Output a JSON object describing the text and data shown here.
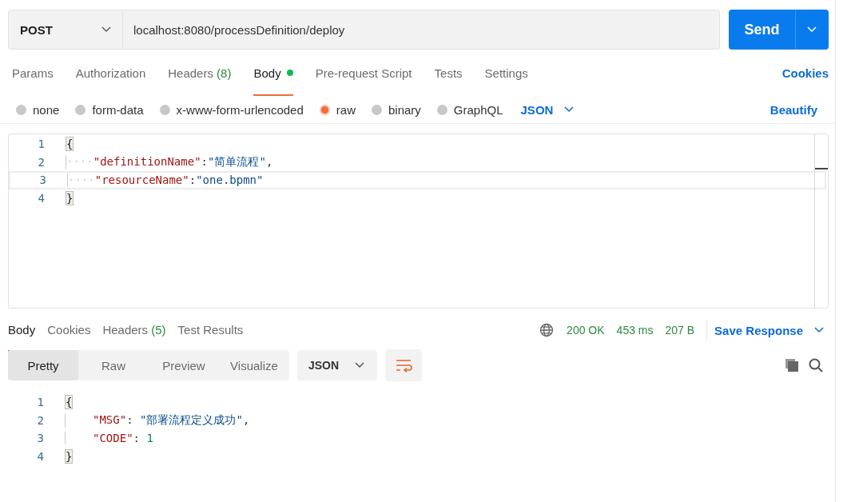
{
  "request": {
    "method": "POST",
    "url": "localhost:8080/processDefinition/deploy",
    "send": "Send"
  },
  "request_tabs": [
    {
      "label": "Params",
      "selected": false,
      "dot": false
    },
    {
      "label": "Authorization",
      "selected": false,
      "dot": false
    },
    {
      "label": "Headers",
      "count": "(8)",
      "selected": false,
      "dot": false
    },
    {
      "label": "Body",
      "selected": true,
      "dot": true
    },
    {
      "label": "Pre-request Script",
      "selected": false,
      "dot": false
    },
    {
      "label": "Tests",
      "selected": false,
      "dot": false
    },
    {
      "label": "Settings",
      "selected": false,
      "dot": false
    }
  ],
  "cookies_link": "Cookies",
  "body_types": [
    {
      "label": "none",
      "selected": false
    },
    {
      "label": "form-data",
      "selected": false
    },
    {
      "label": "x-www-form-urlencoded",
      "selected": false
    },
    {
      "label": "raw",
      "selected": true
    },
    {
      "label": "binary",
      "selected": false
    },
    {
      "label": "GraphQL",
      "selected": false
    }
  ],
  "body_format": "JSON",
  "beautify": "Beautify",
  "request_body": [
    {
      "number": "1",
      "active": false,
      "tokens": [
        {
          "kind": "brace",
          "text": "{"
        }
      ]
    },
    {
      "number": "2",
      "active": false,
      "tokens": [
        {
          "kind": "indent",
          "text": "····"
        },
        {
          "kind": "key",
          "text": "\"definitionName\""
        },
        {
          "kind": "punct",
          "text": ":"
        },
        {
          "kind": "string",
          "text": "\"简单流程\""
        },
        {
          "kind": "punct",
          "text": ","
        }
      ]
    },
    {
      "number": "3",
      "active": true,
      "tokens": [
        {
          "kind": "indent",
          "text": "····"
        },
        {
          "kind": "key",
          "text": "\"resourceName\""
        },
        {
          "kind": "punct",
          "text": ":"
        },
        {
          "kind": "string",
          "text": "\"one.bpmn\""
        }
      ]
    },
    {
      "number": "4",
      "active": false,
      "tokens": [
        {
          "kind": "brace",
          "text": "}"
        }
      ]
    }
  ],
  "response_tabs": [
    {
      "label": "Body",
      "selected": true
    },
    {
      "label": "Cookies",
      "selected": false
    },
    {
      "label": "Headers",
      "count": "(5)",
      "selected": false
    },
    {
      "label": "Test Results",
      "selected": false
    }
  ],
  "response_status": {
    "status": "200 OK",
    "time": "453 ms",
    "size": "207 B",
    "save": "Save Response"
  },
  "view_modes": [
    {
      "label": "Pretty",
      "selected": true
    },
    {
      "label": "Raw",
      "selected": false
    },
    {
      "label": "Preview",
      "selected": false
    },
    {
      "label": "Visualize",
      "selected": false
    }
  ],
  "response_format": "JSON",
  "response_body": [
    {
      "number": "1",
      "indented": false,
      "tokens": [
        {
          "kind": "brace",
          "text": "{"
        }
      ]
    },
    {
      "number": "2",
      "indented": true,
      "tokens": [
        {
          "kind": "key",
          "text": "\"MSG\""
        },
        {
          "kind": "punct",
          "text": ": "
        },
        {
          "kind": "string",
          "text": "\"部署流程定义成功\""
        },
        {
          "kind": "punct",
          "text": ","
        }
      ]
    },
    {
      "number": "3",
      "indented": true,
      "tokens": [
        {
          "kind": "key",
          "text": "\"CODE\""
        },
        {
          "kind": "punct",
          "text": ": "
        },
        {
          "kind": "number",
          "text": "1"
        }
      ]
    },
    {
      "number": "4",
      "indented": false,
      "tokens": [
        {
          "kind": "brace",
          "text": "}"
        }
      ]
    }
  ]
}
